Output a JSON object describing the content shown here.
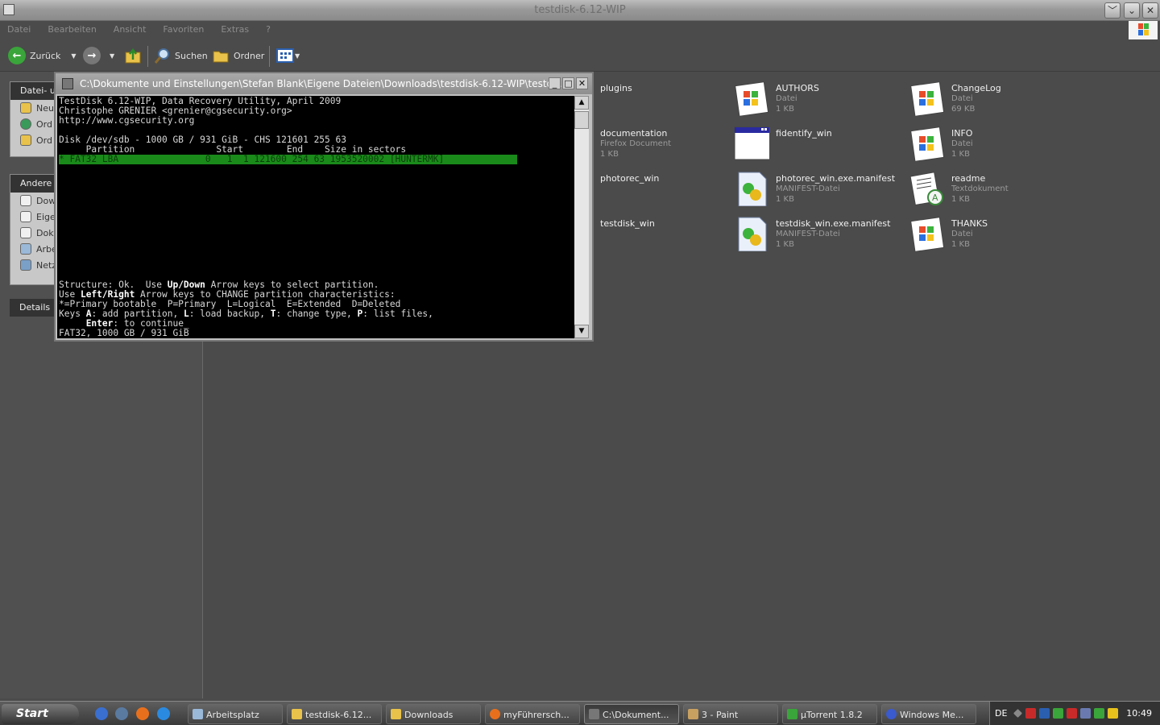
{
  "window": {
    "title": "testdisk-6.12-WIP",
    "minimize": "﹀",
    "restore": "⌄",
    "close": "✕"
  },
  "menu": [
    "Datei",
    "Bearbeiten",
    "Ansicht",
    "Favoriten",
    "Extras",
    "?"
  ],
  "toolbar": {
    "back": "Zurück",
    "search": "Suchen",
    "folders": "Ordner"
  },
  "sidebar": {
    "panel1": {
      "title": "Datei- u",
      "items": [
        "Neu",
        "Ord",
        "Ord"
      ]
    },
    "panel2": {
      "title": "Andere O",
      "items": [
        "Dow",
        "Eige",
        "Dok",
        "Arbe",
        "Netz"
      ]
    },
    "panel3": {
      "title": "Details"
    }
  },
  "files": [
    {
      "name": "plugins",
      "meta1": "",
      "meta2": "",
      "icon": "folder-icon"
    },
    {
      "name": "AUTHORS",
      "meta1": "Datei",
      "meta2": "1 KB",
      "icon": "windows-file-icon"
    },
    {
      "name": "ChangeLog",
      "meta1": "Datei",
      "meta2": "69 KB",
      "icon": "windows-file-icon"
    },
    {
      "name": "documentation",
      "meta1": "Firefox Document",
      "meta2": "1 KB",
      "icon": "firefox-document-icon"
    },
    {
      "name": "fidentify_win",
      "meta1": "",
      "meta2": "",
      "icon": "program-window-icon"
    },
    {
      "name": "INFO",
      "meta1": "Datei",
      "meta2": "1 KB",
      "icon": "windows-file-icon"
    },
    {
      "name": "photorec_win",
      "meta1": "",
      "meta2": "",
      "icon": "program-icon"
    },
    {
      "name": "photorec_win.exe.manifest",
      "meta1": "MANIFEST-Datei",
      "meta2": "1 KB",
      "icon": "manifest-file-icon"
    },
    {
      "name": "readme",
      "meta1": "Textdokument",
      "meta2": "1 KB",
      "icon": "text-document-icon"
    },
    {
      "name": "testdisk_win",
      "meta1": "",
      "meta2": "",
      "icon": "program-icon"
    },
    {
      "name": "testdisk_win.exe.manifest",
      "meta1": "MANIFEST-Datei",
      "meta2": "1 KB",
      "icon": "manifest-file-icon"
    },
    {
      "name": "THANKS",
      "meta1": "Datei",
      "meta2": "1 KB",
      "icon": "windows-file-icon"
    }
  ],
  "console": {
    "title": "C:\\Dokumente und Einstellungen\\Stefan Blank\\Eigene Dateien\\Downloads\\testdisk-6.12-WIP\\testd...",
    "lines": [
      "TestDisk 6.12-WIP, Data Recovery Utility, April 2009",
      "Christophe GRENIER <grenier@cgsecurity.org>",
      "http://www.cgsecurity.org",
      "",
      "Disk /dev/sdb - 1000 GB / 931 GiB - CHS 121601 255 63",
      "     Partition               Start        End    Size in sectors"
    ],
    "selected_row": "* FAT32 LBA                0   1  1 121600 254 63 1953520002 [HUNTERMK]",
    "help1_a": "Structure: Ok.  Use ",
    "help1_b": "Up/Down",
    "help1_c": " Arrow keys to select partition.",
    "help2_a": "Use ",
    "help2_b": "Left/Right",
    "help2_c": " Arrow keys to CHANGE partition characteristics:",
    "help3": "*=Primary bootable  P=Primary  L=Logical  E=Extended  D=Deleted",
    "help4_a": "Keys ",
    "help4_b": "A",
    "help4_c": ": add partition, ",
    "help4_d": "L",
    "help4_e": ": load backup, ",
    "help4_f": "T",
    "help4_g": ": change type, ",
    "help4_h": "P",
    "help4_i": ": list files,",
    "help5_a": "     ",
    "help5_b": "Enter",
    "help5_c": ": to continue_",
    "status": "FAT32, 1000 GB / 931 GiB"
  },
  "taskbar": {
    "start": "Start",
    "tasks": [
      "Arbeitsplatz",
      "testdisk-6.12...",
      "Downloads",
      "myFührersch...",
      "C:\\Dokument...",
      "3 - Paint",
      "µTorrent 1.8.2",
      "Windows Me..."
    ],
    "lang": "DE",
    "clock": "10:49"
  },
  "colors": {
    "highlight": "#1a8a1a",
    "terminal_bg": "#000000",
    "accent_back": "#3aa53a"
  }
}
